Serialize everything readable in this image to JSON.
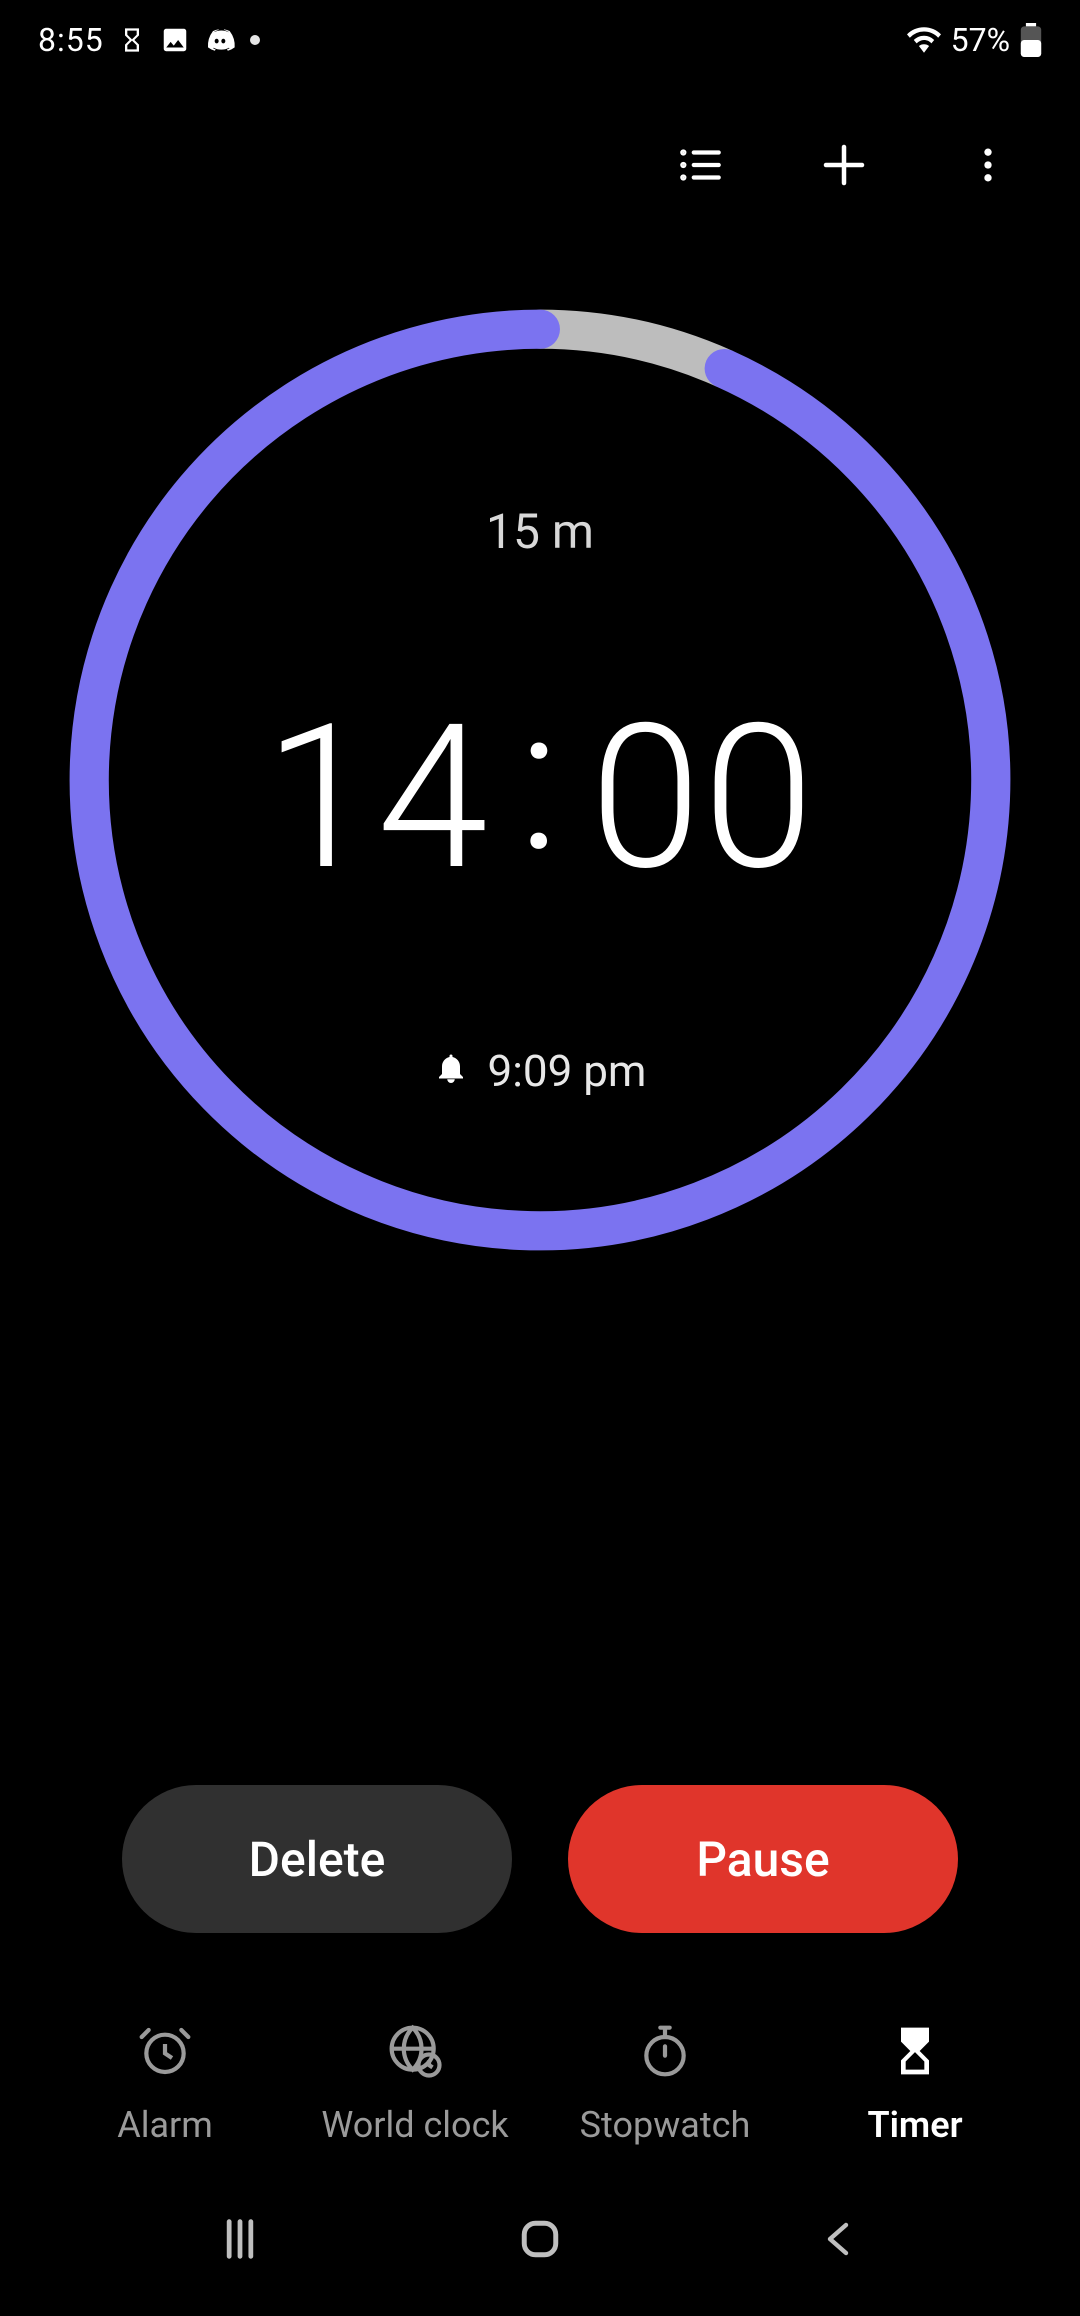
{
  "status": {
    "time": "8:55",
    "battery_percent": "57%"
  },
  "timer": {
    "total_label": "15 m",
    "minutes": "14",
    "seconds": "00",
    "end_time": "9:09 pm",
    "progress_fraction": 0.933
  },
  "buttons": {
    "delete": "Delete",
    "pause": "Pause"
  },
  "tabs": {
    "alarm": "Alarm",
    "world_clock": "World clock",
    "stopwatch": "Stopwatch",
    "timer": "Timer"
  },
  "colors": {
    "ring_progress": "#7B73F0",
    "ring_track": "#bdbdbd",
    "pause_bg": "#e0352b",
    "delete_bg": "#303030"
  }
}
